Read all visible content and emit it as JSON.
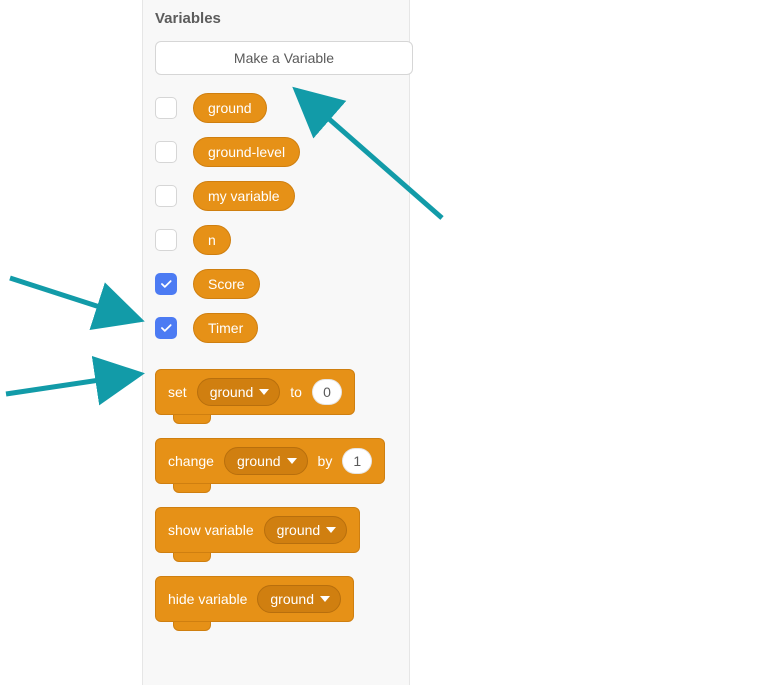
{
  "section": {
    "title": "Variables"
  },
  "buttons": {
    "make_variable": "Make a Variable"
  },
  "variables": [
    {
      "name": "ground",
      "checked": false
    },
    {
      "name": "ground-level",
      "checked": false
    },
    {
      "name": "my variable",
      "checked": false
    },
    {
      "name": "n",
      "checked": false
    },
    {
      "name": "Score",
      "checked": true
    },
    {
      "name": "Timer",
      "checked": true
    }
  ],
  "blocks": {
    "set": {
      "label_set": "set",
      "dropdown": "ground",
      "label_to": "to",
      "value": "0"
    },
    "change": {
      "label_change": "change",
      "dropdown": "ground",
      "label_by": "by",
      "value": "1"
    },
    "show": {
      "label": "show variable",
      "dropdown": "ground"
    },
    "hide": {
      "label": "hide variable",
      "dropdown": "ground"
    }
  },
  "annotations": {
    "arrow_color": "#129ba8"
  }
}
